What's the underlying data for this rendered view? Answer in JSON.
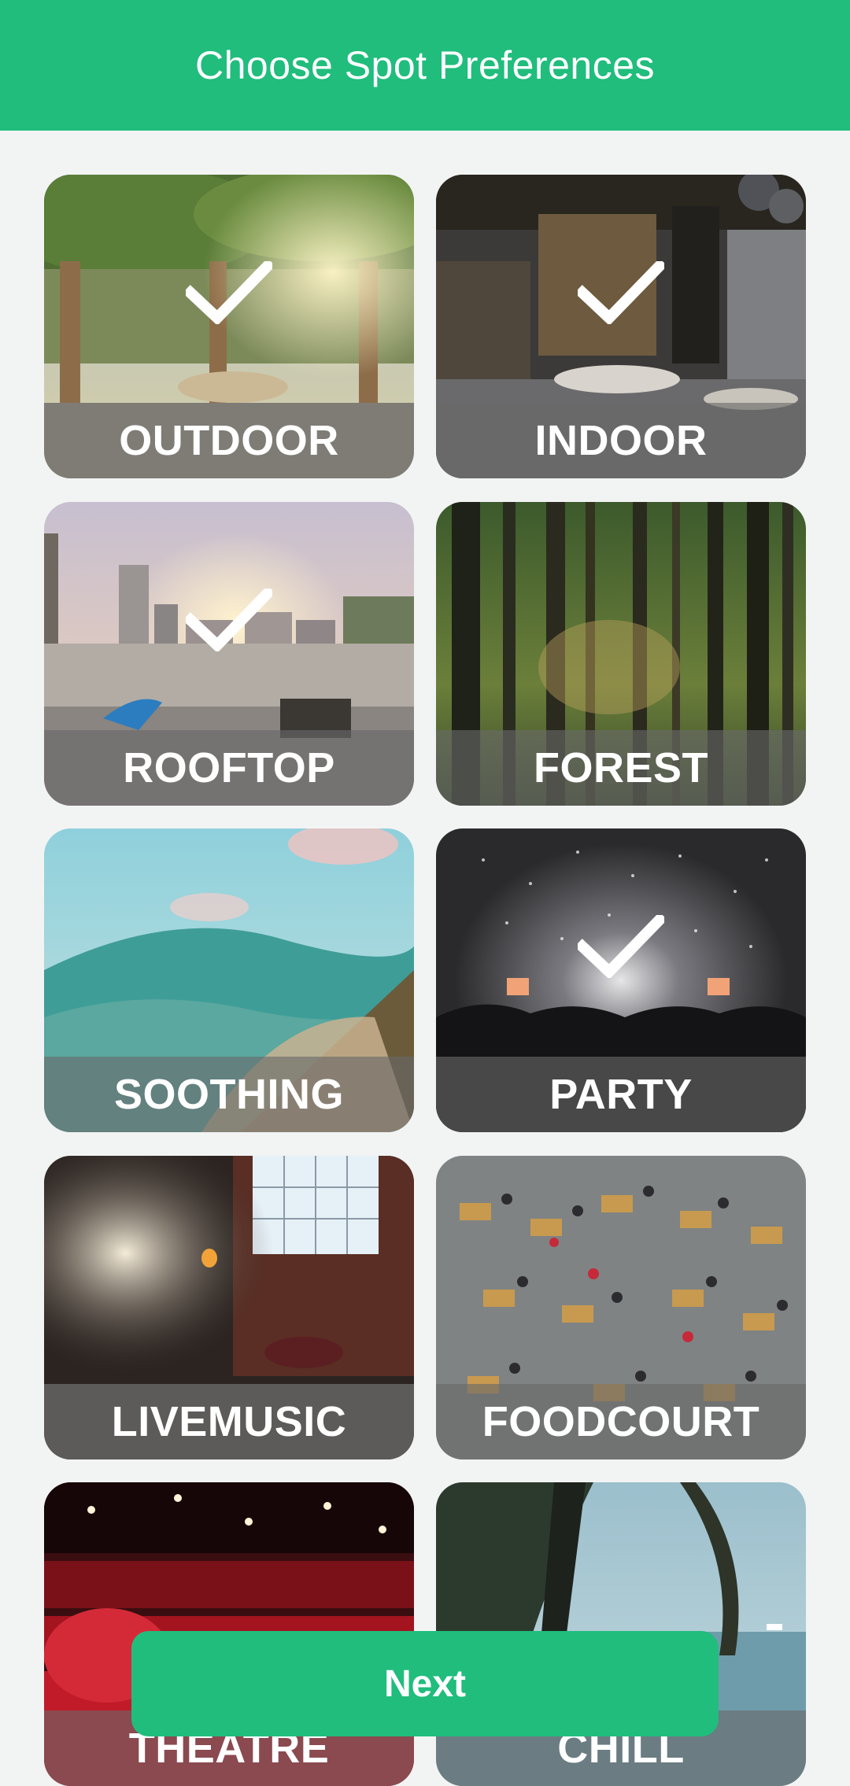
{
  "header": {
    "title": "Choose Spot Preferences"
  },
  "spots": [
    {
      "label": "OUTDOOR",
      "selected": true,
      "scene": "outdoor"
    },
    {
      "label": "INDOOR",
      "selected": true,
      "scene": "indoor"
    },
    {
      "label": "ROOFTOP",
      "selected": true,
      "scene": "rooftop"
    },
    {
      "label": "FOREST",
      "selected": false,
      "scene": "forest"
    },
    {
      "label": "SOOTHING",
      "selected": false,
      "scene": "soothing"
    },
    {
      "label": "PARTY",
      "selected": true,
      "scene": "party"
    },
    {
      "label": "LIVEMUSIC",
      "selected": false,
      "scene": "livemusic"
    },
    {
      "label": "FOODCOURT",
      "selected": false,
      "scene": "foodcourt"
    },
    {
      "label": "THEATRE",
      "selected": false,
      "scene": "theatre"
    },
    {
      "label": "CHILL",
      "selected": false,
      "scene": "chill"
    }
  ],
  "footer": {
    "next_label": "Next"
  },
  "colors": {
    "accent": "#20bd7d",
    "background": "#f2f4f3",
    "label_band": "#696969"
  },
  "icons": {
    "selected": "check-icon"
  }
}
